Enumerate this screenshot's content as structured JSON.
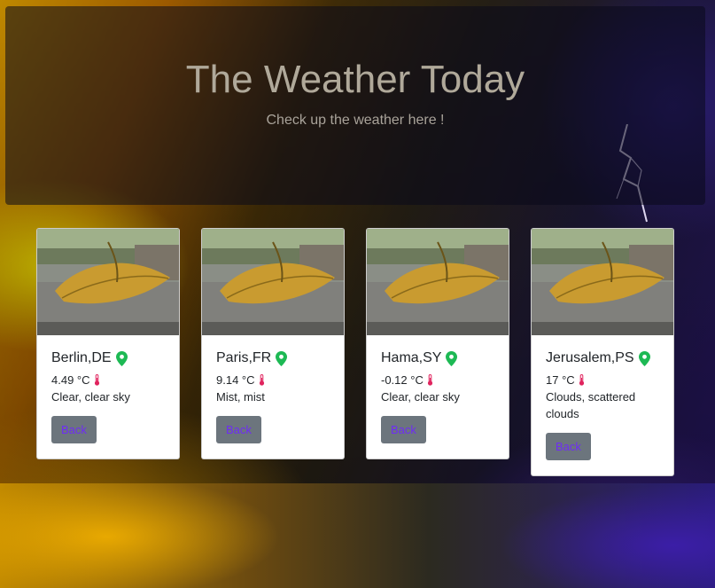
{
  "header": {
    "title": "The Weather Today",
    "subtitle": "Check up the weather here !"
  },
  "cards": [
    {
      "city": "Berlin,DE",
      "temp": "4.49 °C",
      "desc": "Clear, clear sky",
      "button": "Back"
    },
    {
      "city": "Paris,FR",
      "temp": "9.14 °C",
      "desc": "Mist, mist",
      "button": "Back"
    },
    {
      "city": "Hama,SY",
      "temp": "-0.12 °C",
      "desc": "Clear, clear sky",
      "button": "Back"
    },
    {
      "city": "Jerusalem,PS",
      "temp": "17 °C",
      "desc": "Clouds, scattered clouds",
      "button": "Back"
    }
  ],
  "icons": {
    "location": "map-pin-icon",
    "temperature": "thermometer-icon"
  },
  "colors": {
    "pin": "#1db954",
    "thermometer": "#e0245e",
    "button_bg": "#6c757d",
    "button_text": "#6f2cf5"
  }
}
